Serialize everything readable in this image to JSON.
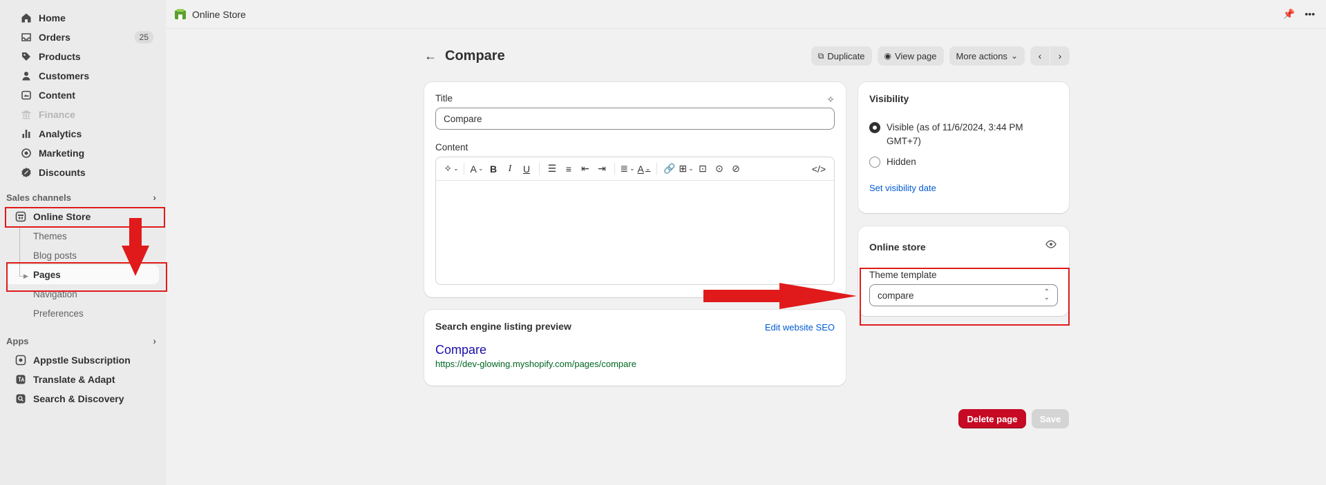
{
  "sidebar": {
    "items": [
      {
        "label": "Home",
        "icon": "home-icon"
      },
      {
        "label": "Orders",
        "icon": "orders-icon",
        "badge": "25"
      },
      {
        "label": "Products",
        "icon": "tag-icon"
      },
      {
        "label": "Customers",
        "icon": "person-icon"
      },
      {
        "label": "Content",
        "icon": "content-icon"
      },
      {
        "label": "Finance",
        "icon": "bank-icon"
      },
      {
        "label": "Analytics",
        "icon": "bar-chart-icon"
      },
      {
        "label": "Marketing",
        "icon": "target-icon"
      },
      {
        "label": "Discounts",
        "icon": "discount-icon"
      }
    ],
    "sales_channels_label": "Sales channels",
    "online_store": "Online Store",
    "sub_items": [
      "Themes",
      "Blog posts",
      "Pages",
      "Navigation",
      "Preferences"
    ],
    "apps_label": "Apps",
    "apps": [
      "Appstle Subscription",
      "Translate & Adapt",
      "Search & Discovery"
    ]
  },
  "topbar": {
    "store_name": "Online Store"
  },
  "header": {
    "title": "Compare",
    "duplicate": "Duplicate",
    "view_page": "View page",
    "more_actions": "More actions"
  },
  "main": {
    "title_label": "Title",
    "title_value": "Compare",
    "content_label": "Content"
  },
  "seo": {
    "heading": "Search engine listing preview",
    "edit_link": "Edit website SEO",
    "preview_title": "Compare",
    "preview_url": "https://dev-glowing.myshopify.com/pages/compare"
  },
  "visibility": {
    "heading": "Visibility",
    "visible_label": "Visible (as of 11/6/2024, 3:44 PM GMT+7)",
    "hidden_label": "Hidden",
    "set_date": "Set visibility date"
  },
  "online_store_card": {
    "heading": "Online store",
    "template_label": "Theme template",
    "template_value": "compare"
  },
  "footer": {
    "delete": "Delete page",
    "save": "Save"
  },
  "colors": {
    "annotation": "#e01a1a",
    "danger": "#c70a24",
    "link": "#005bd3"
  }
}
